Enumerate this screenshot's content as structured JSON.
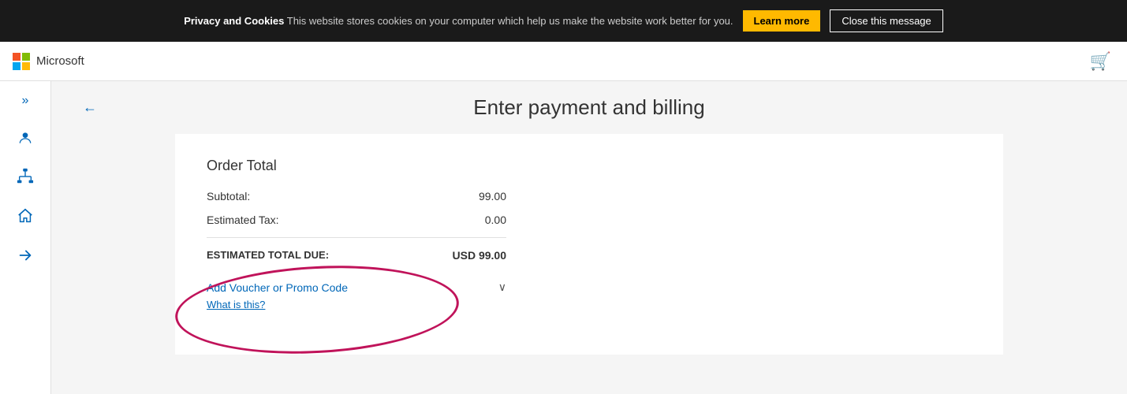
{
  "cookie_banner": {
    "text_bold": "Privacy and Cookies",
    "text_normal": " This website stores cookies on your computer which help us make the website work better for you.",
    "learn_more_label": "Learn more",
    "close_label": "Close this message"
  },
  "header": {
    "logo_text": "Microsoft",
    "cart_icon": "🛒"
  },
  "sidebar": {
    "chevron_label": "»",
    "icons": [
      "person",
      "network",
      "home",
      "arrow-right"
    ]
  },
  "page": {
    "back_label": "←",
    "title": "Enter payment and billing"
  },
  "order_summary": {
    "title": "Order Total",
    "subtotal_label": "Subtotal:",
    "subtotal_value": "99.00",
    "tax_label": "Estimated Tax:",
    "tax_value": "0.00",
    "total_label": "ESTIMATED TOTAL DUE:",
    "total_value": "USD 99.00"
  },
  "voucher": {
    "label": "Add Voucher or Promo Code",
    "what_is_this": "What is this?"
  }
}
